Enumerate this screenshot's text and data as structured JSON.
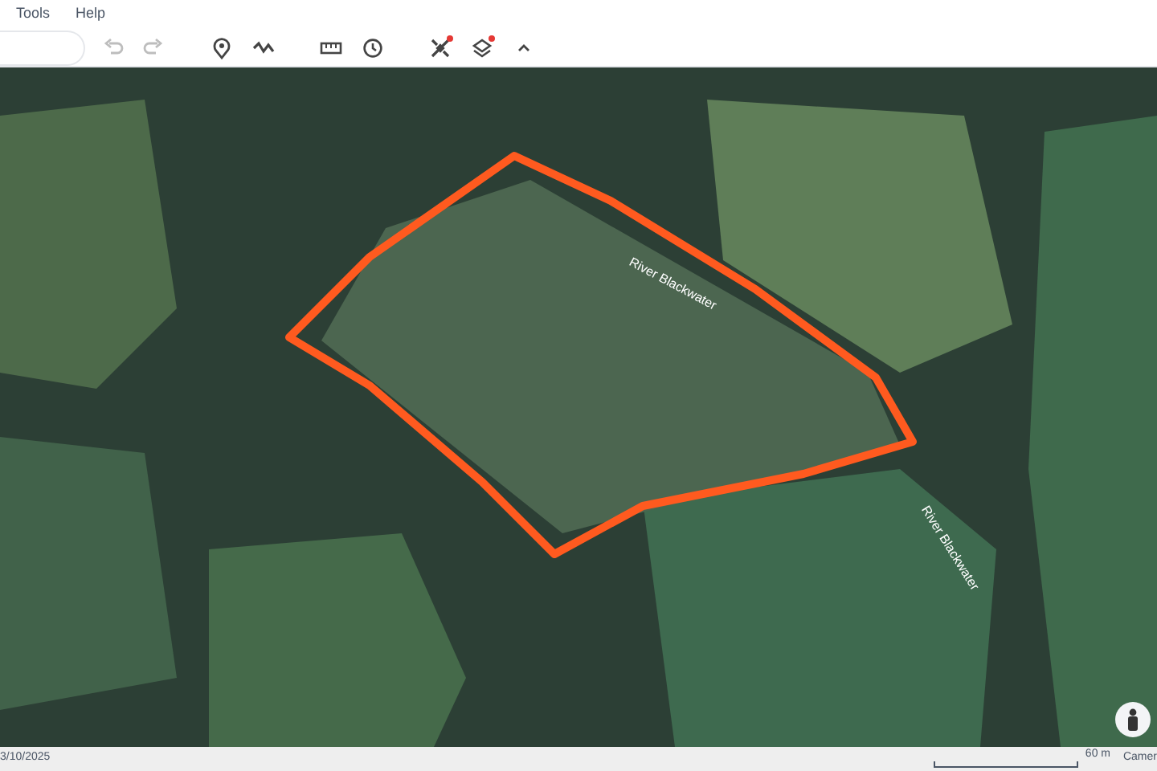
{
  "menu": [
    {
      "label": "Tools"
    },
    {
      "label": "Help"
    }
  ],
  "toolbar": [
    {
      "kind": "undo",
      "disabled": true,
      "badge": false
    },
    {
      "kind": "redo",
      "disabled": true,
      "badge": false
    },
    {
      "kind": "sep"
    },
    {
      "kind": "pin",
      "disabled": false,
      "badge": false
    },
    {
      "kind": "path",
      "disabled": false,
      "badge": false
    },
    {
      "kind": "sep"
    },
    {
      "kind": "ruler",
      "disabled": false,
      "badge": false
    },
    {
      "kind": "history",
      "disabled": false,
      "badge": false
    },
    {
      "kind": "sep"
    },
    {
      "kind": "satellite",
      "disabled": false,
      "badge": true
    },
    {
      "kind": "layers",
      "disabled": false,
      "badge": true
    },
    {
      "kind": "collapse",
      "disabled": false,
      "badge": false
    }
  ],
  "map": {
    "labels": [
      {
        "text": "River Blackwater"
      },
      {
        "text": "River Blackwater"
      }
    ]
  },
  "status_bar": {
    "date": "3/10/2025",
    "scale": "60 m",
    "camera": "Camer"
  }
}
